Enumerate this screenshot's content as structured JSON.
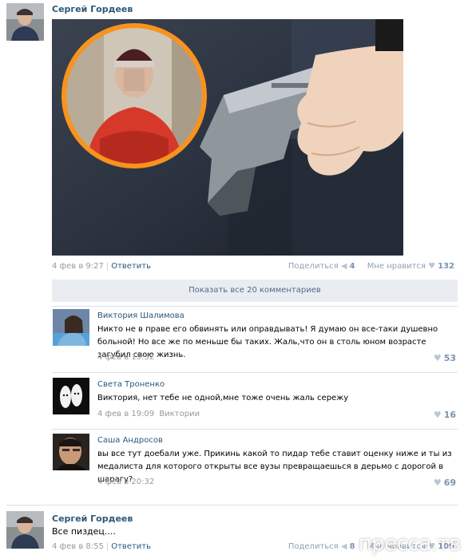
{
  "post1": {
    "author": "Сергей Гордеев",
    "date": "4 фев в 9:27",
    "reply": "Ответить",
    "share_label": "Поделиться",
    "share_count": "4",
    "like_label": "Мне нравится",
    "like_count": "132"
  },
  "show_all": "Показать все 20 комментариев",
  "comments": [
    {
      "name": "Виктория Шалимова",
      "text": "Никто не в праве его обвинять или оправдывать! Я думаю он все-таки душевно больной! Но все же по меньше бы таких. Жаль,что он в столь юном возрасте загубил свою жизнь.",
      "date": "4 фев в 15:52",
      "reply_to": "",
      "likes": "53"
    },
    {
      "name": "Света Троненко",
      "text": "Виктория, нет тебе не одной,мне тоже очень жаль сережу",
      "date": "4 фев в 19:09",
      "reply_to": "Виктории",
      "likes": "16"
    },
    {
      "name": "Саша Андросов",
      "text": "вы все тут доебали уже. Прикинь какой то пидар тебе ставит оценку ниже и ты из медалиста для которого открыты все вузы превращаешься в дерьмо с дорогой в шарагу?",
      "date": "4 фев в 20:32",
      "reply_to": "",
      "likes": "69"
    }
  ],
  "post2": {
    "author": "Сергей Гордеев",
    "text": "Все пиздец....",
    "date": "4 фев в 8:55",
    "reply": "Ответить",
    "share_label": "Поделиться",
    "share_count": "8",
    "like_label": "Мне нравится",
    "like_count": "109"
  },
  "watermark": "пресса.тв",
  "colors": {
    "link": "#2b587a",
    "meta": "#999999",
    "bar": "#e9edf1",
    "border": "#dae1e8",
    "accent_ring": "#f7931e"
  }
}
